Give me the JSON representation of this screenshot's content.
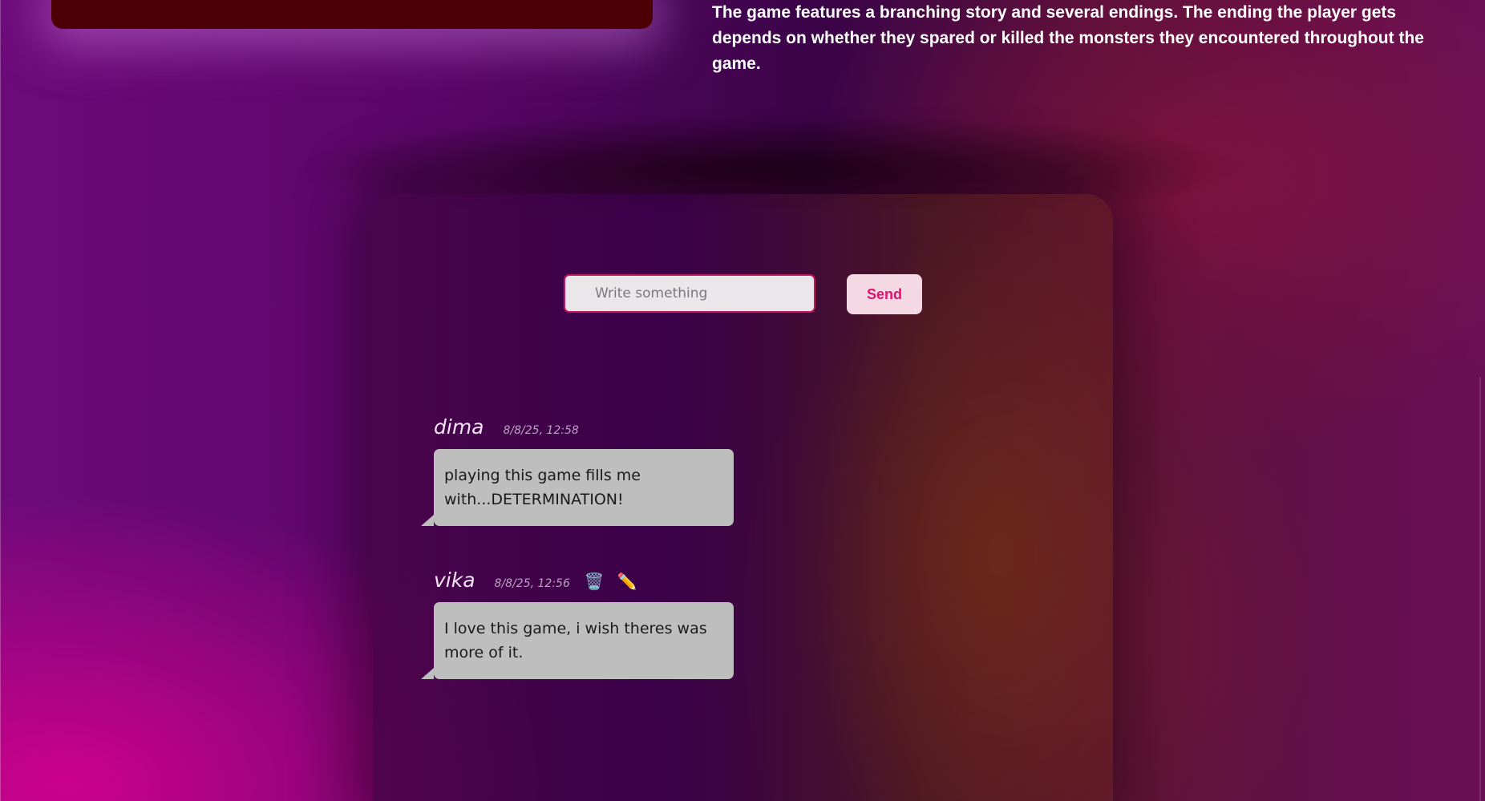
{
  "game_info": {
    "description": "The game features a branching story and several endings. The ending the player gets depends on whether they spared or killed the monsters they encountered throughout the game."
  },
  "composer": {
    "placeholder": "Write something",
    "send_label": "Send"
  },
  "messages": [
    {
      "author": "dima",
      "time": "8/8/25, 12:58",
      "text": "playing this game fills me with...DETERMINATION!",
      "actions": []
    },
    {
      "author": "vika",
      "time": "8/8/25, 12:56",
      "text": "I love this game, i wish theres was more of it.",
      "actions": [
        "delete-icon",
        "edit-icon"
      ],
      "action_glyphs": {
        "delete": "🗑️",
        "edit": "✏️"
      }
    }
  ],
  "colors": {
    "accent": "#e0126d",
    "input_border": "#c2185b",
    "bubble": "#bebebe",
    "top_card": "#4c0005"
  }
}
